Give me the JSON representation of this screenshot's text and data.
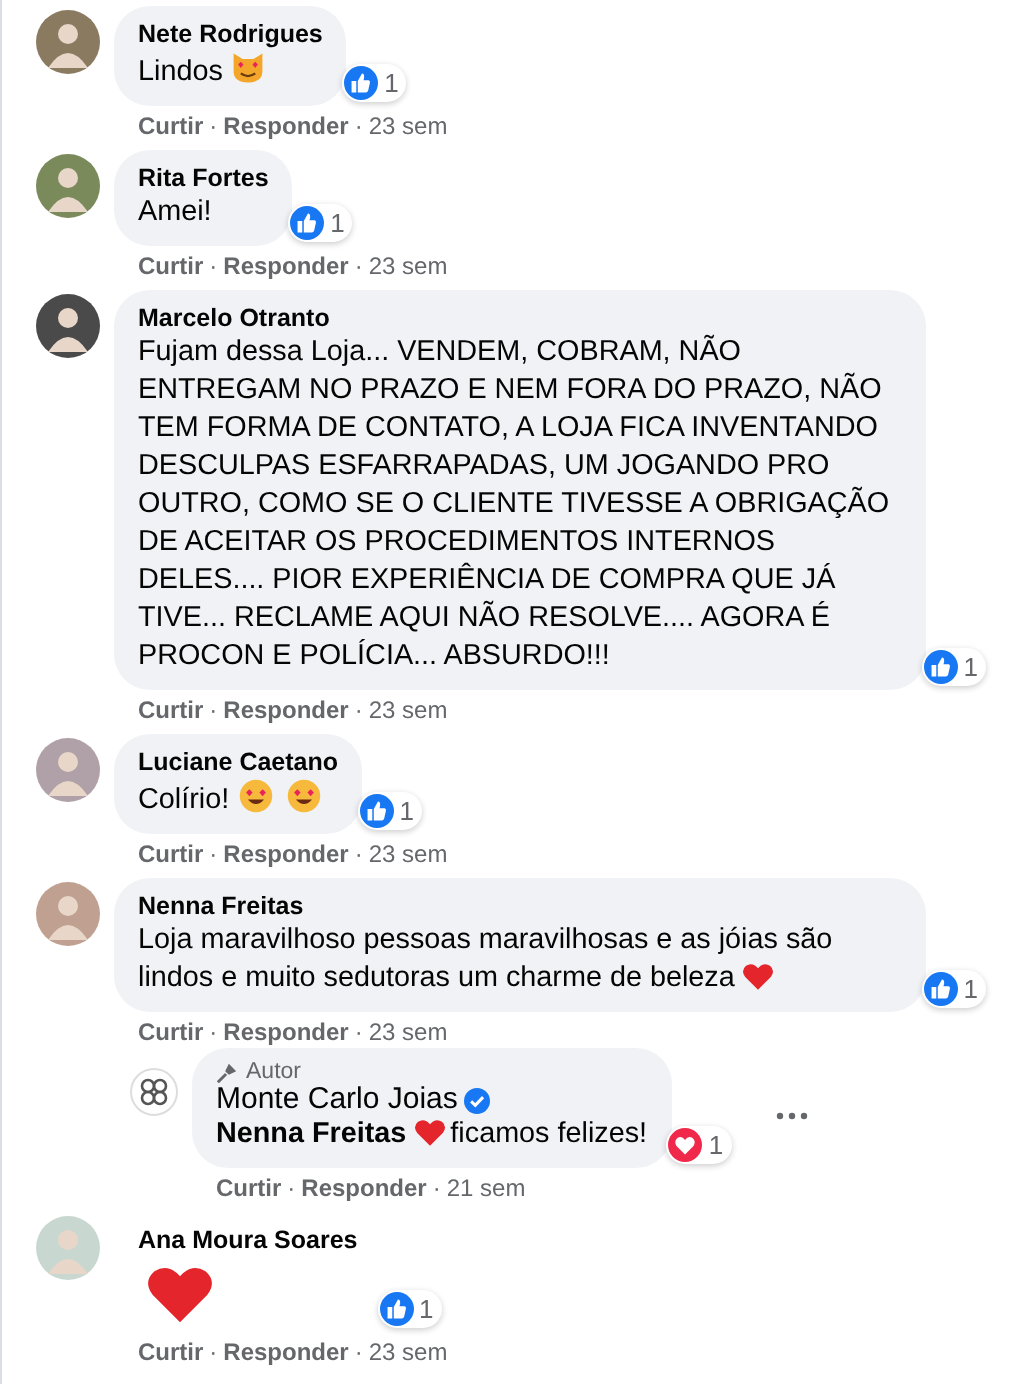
{
  "comments": [
    {
      "author": "Nete Rodrigues",
      "bubble": true,
      "body": [
        {
          "kind": "text",
          "text": "Lindos"
        },
        {
          "kind": "heart-eyes-cat"
        }
      ],
      "reaction": {
        "kind": "like",
        "count": "1"
      },
      "actions": [
        {
          "kind": "link",
          "label": "Curtir"
        },
        {
          "kind": "dot",
          "label": "·"
        },
        {
          "kind": "link",
          "label": "Responder"
        },
        {
          "kind": "dot",
          "label": "·"
        },
        {
          "kind": "time",
          "label": "23 sem"
        }
      ]
    },
    {
      "author": "Rita Fortes",
      "bubble": true,
      "body": [
        {
          "kind": "text",
          "text": "Amei!"
        }
      ],
      "reaction": {
        "kind": "like",
        "count": "1"
      },
      "actions": [
        {
          "kind": "link",
          "label": "Curtir"
        },
        {
          "kind": "dot",
          "label": "·"
        },
        {
          "kind": "link",
          "label": "Responder"
        },
        {
          "kind": "dot",
          "label": "·"
        },
        {
          "kind": "time",
          "label": "23 sem"
        }
      ]
    },
    {
      "author": "Marcelo Otranto",
      "bubble": true,
      "body": [
        {
          "kind": "text",
          "text": "Fujam dessa Loja... VENDEM, COBRAM, NÃO ENTREGAM NO PRAZO E NEM FORA DO PRAZO, NÃO TEM FORMA DE CONTATO, A LOJA FICA INVENTANDO DESCULPAS ESFARRAPADAS, UM JOGANDO PRO OUTRO, COMO SE O CLIENTE TIVESSE A OBRIGAÇÃO DE ACEITAR OS PROCEDIMENTOS INTERNOS DELES.... PIOR EXPERIÊNCIA DE COMPRA QUE JÁ TIVE... RECLAME AQUI NÃO RESOLVE.... AGORA É PROCON E POLÍCIA... ABSURDO!!!"
        }
      ],
      "reaction": {
        "kind": "like",
        "count": "1"
      },
      "actions": [
        {
          "kind": "link",
          "label": "Curtir"
        },
        {
          "kind": "dot",
          "label": "·"
        },
        {
          "kind": "link",
          "label": "Responder"
        },
        {
          "kind": "dot",
          "label": "·"
        },
        {
          "kind": "time",
          "label": "23 sem"
        }
      ]
    },
    {
      "author": "Luciane Caetano",
      "bubble": true,
      "body": [
        {
          "kind": "text",
          "text": "Colírio!"
        },
        {
          "kind": "heart-eyes"
        },
        {
          "kind": "heart-eyes"
        }
      ],
      "reaction": {
        "kind": "like",
        "count": "1"
      },
      "actions": [
        {
          "kind": "link",
          "label": "Curtir"
        },
        {
          "kind": "dot",
          "label": "·"
        },
        {
          "kind": "link",
          "label": "Responder"
        },
        {
          "kind": "dot",
          "label": "·"
        },
        {
          "kind": "time",
          "label": "23 sem"
        }
      ]
    },
    {
      "author": "Nenna Freitas",
      "bubble": true,
      "body": [
        {
          "kind": "text",
          "text": "Loja maravilhoso pessoas maravilhosas e as jóias são lindos e muito sedutoras um charme de beleza"
        },
        {
          "kind": "heart"
        }
      ],
      "reaction": {
        "kind": "like",
        "count": "1"
      },
      "actions": [
        {
          "kind": "link",
          "label": "Curtir"
        },
        {
          "kind": "dot",
          "label": "·"
        },
        {
          "kind": "link",
          "label": "Responder"
        },
        {
          "kind": "dot",
          "label": "·"
        },
        {
          "kind": "time",
          "label": "23 sem"
        }
      ],
      "replies": [
        {
          "author": "Monte Carlo Joias",
          "author_badge": "Autor",
          "verified": true,
          "bubble": true,
          "body": [
            {
              "kind": "mention",
              "text": "Nenna Freitas"
            },
            {
              "kind": "heart"
            },
            {
              "kind": "text",
              "text": "ficamos felizes!"
            }
          ],
          "reaction": {
            "kind": "love",
            "count": "1"
          },
          "actions": [
            {
              "kind": "link",
              "label": "Curtir"
            },
            {
              "kind": "dot",
              "label": "·"
            },
            {
              "kind": "link",
              "label": "Responder"
            },
            {
              "kind": "dot",
              "label": "·"
            },
            {
              "kind": "time",
              "label": "21 sem"
            }
          ]
        }
      ]
    },
    {
      "author": "Ana Moura Soares",
      "bubble": false,
      "body": [
        {
          "kind": "heart"
        }
      ],
      "reaction": {
        "kind": "like",
        "count": "1"
      },
      "actions": [
        {
          "kind": "link",
          "label": "Curtir"
        },
        {
          "kind": "dot",
          "label": "·"
        },
        {
          "kind": "link",
          "label": "Responder"
        },
        {
          "kind": "dot",
          "label": "·"
        },
        {
          "kind": "time",
          "label": "23 sem"
        }
      ]
    }
  ]
}
